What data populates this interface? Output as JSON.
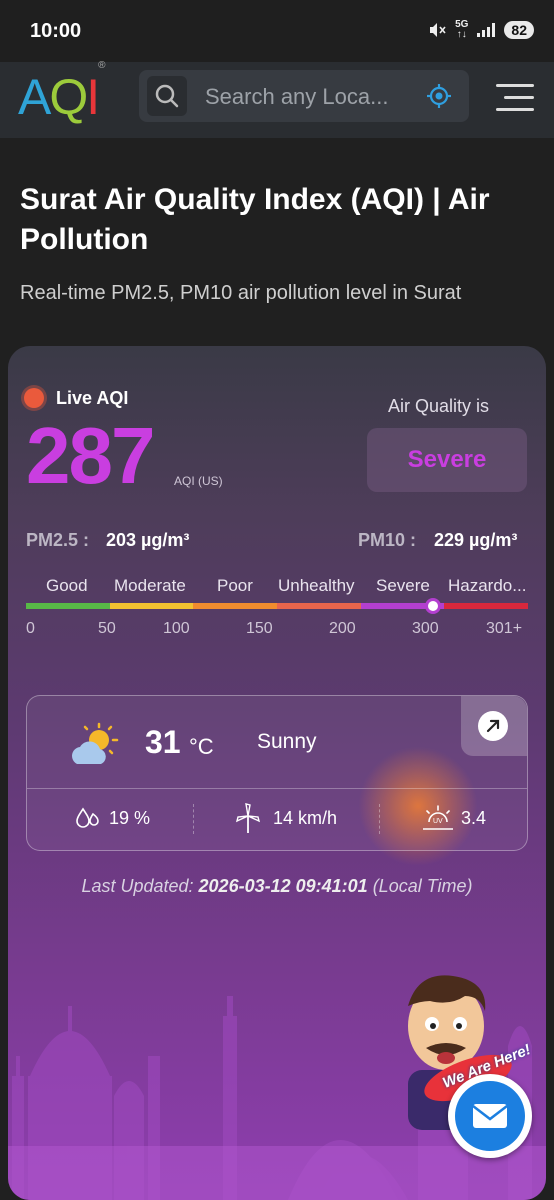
{
  "status_bar": {
    "time": "10:00",
    "battery": "82",
    "network": "5G"
  },
  "header": {
    "logo": {
      "a": "A",
      "q": "Q",
      "i": "I",
      "mark": "®"
    },
    "search_placeholder": "Search any Loca...",
    "icons": [
      "search-icon",
      "locate-icon",
      "menu-icon"
    ]
  },
  "page": {
    "title": "Surat Air Quality Index (AQI) | Air Pollution",
    "subtitle": "Real-time PM2.5, PM10 air pollution level in Surat"
  },
  "aqi_card": {
    "live_label": "Live AQI",
    "aqi_value": "287",
    "aqi_unit": "AQI (US)",
    "air_quality_is": "Air Quality is",
    "severity": "Severe",
    "pm25_label": "PM2.5 :",
    "pm25_value": "203 µg/m³",
    "pm10_label": "PM10 :",
    "pm10_value": "229 µg/m³",
    "scale": {
      "categories": [
        "Good",
        "Moderate",
        "Poor",
        "Unhealthy",
        "Severe",
        "Hazardo..."
      ],
      "numbers": [
        "0",
        "50",
        "100",
        "150",
        "200",
        "300",
        "301+"
      ],
      "colors": [
        "#58b947",
        "#f2c230",
        "#f08c2e",
        "#e8654c",
        "#b33fcf",
        "#d8283c"
      ],
      "marker_value": 287
    },
    "weather": {
      "temperature": "31",
      "temp_unit": "°C",
      "condition": "Sunny",
      "humidity": "19 %",
      "wind": "14 km/h",
      "uv": "3.4"
    },
    "last_updated_label": "Last Updated:",
    "last_updated_value": "2026-03-12 09:41:01",
    "last_updated_suffix": "(Local Time)",
    "mascot_text": "We Are Here!"
  },
  "colors": {
    "accent": "#c93ee0",
    "live_dot": "#ea5a3c",
    "header_bg": "#2a2d31"
  }
}
